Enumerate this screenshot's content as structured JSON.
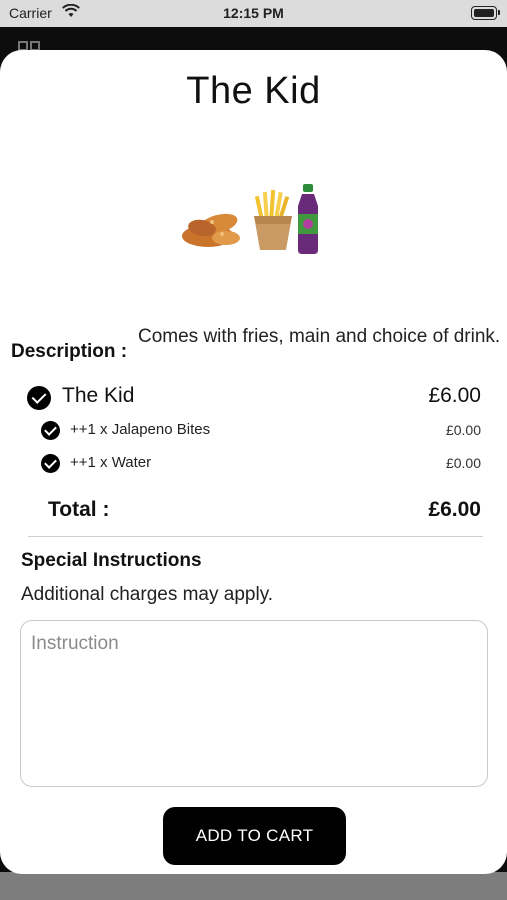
{
  "status_bar": {
    "carrier": "Carrier",
    "time": "12:15 PM"
  },
  "product": {
    "title": "The Kid",
    "image": "kids-meal-image"
  },
  "description": {
    "label": "Description :",
    "text": "Comes with fries, main and choice of drink."
  },
  "order": {
    "item": {
      "name": "The Kid",
      "price": "£6.00"
    },
    "options": [
      {
        "name": "++1 x Jalapeno Bites",
        "price": "£0.00"
      },
      {
        "name": "++1 x Water",
        "price": "£0.00"
      }
    ],
    "total_label": "Total :",
    "total_value": "£6.00"
  },
  "special_instructions": {
    "title": "Special Instructions",
    "note": "Additional charges may apply.",
    "placeholder": "Instruction",
    "value": ""
  },
  "actions": {
    "add_to_cart": "ADD TO CART"
  },
  "colors": {
    "button": "#000000",
    "modal": "#ffffff",
    "overlay": "#0d0d0d"
  }
}
